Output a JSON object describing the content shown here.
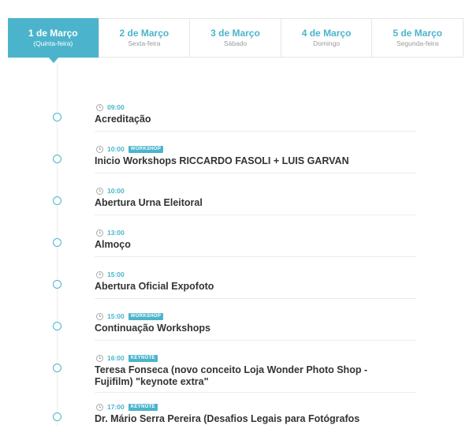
{
  "tabs": [
    {
      "date": "1 de Março",
      "weekday": "(Quinta-feira)",
      "active": true
    },
    {
      "date": "2 de Março",
      "weekday": "Sexta-feira"
    },
    {
      "date": "3 de Março",
      "weekday": "Sábado"
    },
    {
      "date": "4 de Março",
      "weekday": "Domingo"
    },
    {
      "date": "5 de Março",
      "weekday": "Segunda-feira"
    }
  ],
  "events": [
    {
      "time": "09:00",
      "badge": "",
      "title": "Acreditação"
    },
    {
      "time": "10:00",
      "badge": "WORKSHOP",
      "title": "Inicio Workshops RICCARDO FASOLI + LUIS GARVAN"
    },
    {
      "time": "10:00",
      "badge": "",
      "title": "Abertura Urna Eleitoral"
    },
    {
      "time": "13:00",
      "badge": "",
      "title": "Almoço"
    },
    {
      "time": "15:00",
      "badge": "",
      "title": "Abertura Oficial Expofoto"
    },
    {
      "time": "15:00",
      "badge": "WORKSHOP",
      "title": "Continuação Workshops"
    },
    {
      "time": "16:00",
      "badge": "KEYNOTE",
      "title": "Teresa Fonseca (novo conceito Loja Wonder Photo Shop - Fujifilm) \"keynote extra\""
    },
    {
      "time": "17:00",
      "badge": "KEYNOTE",
      "title": "Dr. Mário Serra Pereira (Desafios Legais para Fotógrafos"
    }
  ],
  "colors": {
    "accent": "#4bb4cc",
    "text": "#333333",
    "muted": "#9a9a9a"
  },
  "icons": {
    "time": "clock-icon",
    "timeline": "circle-icon"
  }
}
